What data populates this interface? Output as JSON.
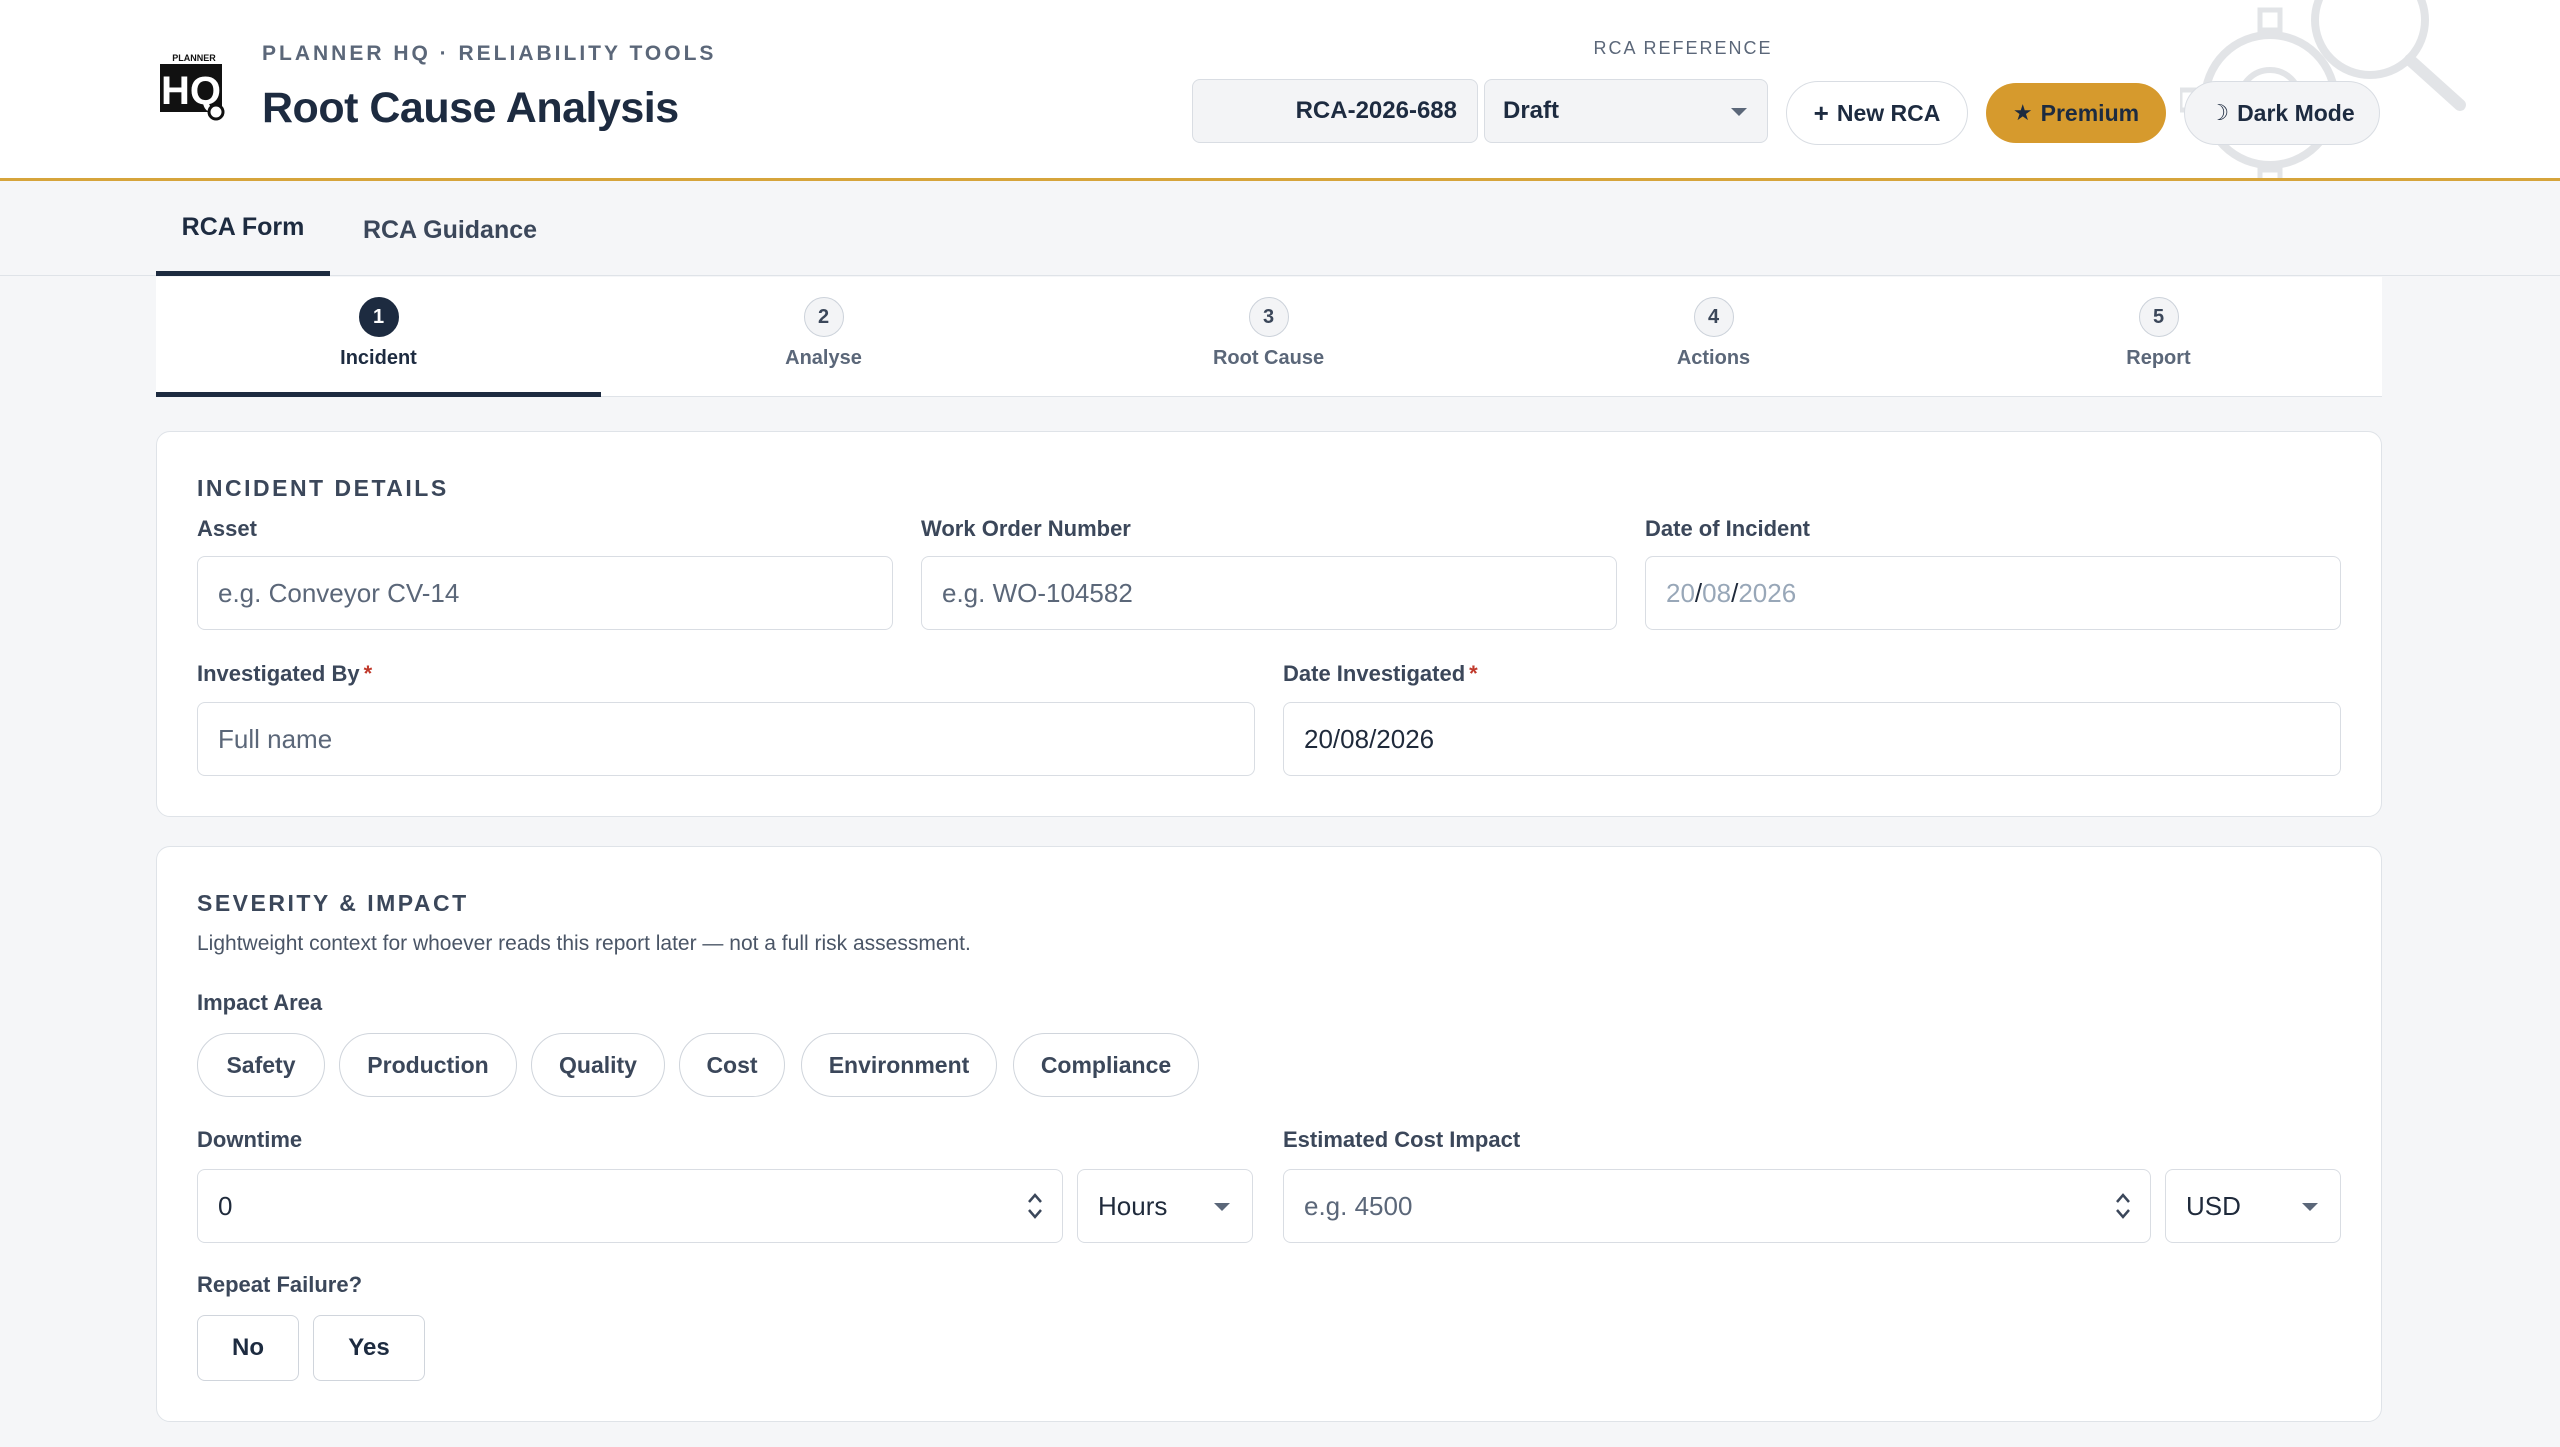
{
  "app": {
    "eyebrow": "PLANNER HQ · RELIABILITY TOOLS",
    "title": "Root Cause Analysis",
    "logo_text_top": "PLANNER",
    "logo_text_main": "HQ"
  },
  "header": {
    "rca_reference_label": "RCA REFERENCE",
    "rca_reference_value": "RCA-2026-688",
    "status_value": "Draft",
    "new_rca_label": "New RCA",
    "premium_label": "Premium",
    "dark_mode_label": "Dark Mode",
    "colors": {
      "accent": "#d6a43b",
      "premium_bg": "#d69a2d",
      "navy": "#1d2b40"
    }
  },
  "tabs": [
    {
      "label": "RCA Form",
      "active": true
    },
    {
      "label": "RCA Guidance",
      "active": false
    }
  ],
  "steps": [
    {
      "num": "1",
      "label": "Incident",
      "active": true
    },
    {
      "num": "2",
      "label": "Analyse",
      "active": false
    },
    {
      "num": "3",
      "label": "Root Cause",
      "active": false
    },
    {
      "num": "4",
      "label": "Actions",
      "active": false
    },
    {
      "num": "5",
      "label": "Report",
      "active": false
    }
  ],
  "incident": {
    "title": "INCIDENT DETAILS",
    "asset_label": "Asset",
    "asset_placeholder": "e.g. Conveyor CV-14",
    "work_order_label": "Work Order Number",
    "work_order_placeholder": "e.g. WO-104582",
    "date_incident_label": "Date of Incident",
    "date_incident_day": "20",
    "date_incident_month": "08",
    "date_incident_year": "2026",
    "date_sep": "/",
    "investigated_by_label": "Investigated By",
    "investigated_by_placeholder": "Full name",
    "required_mark": "*",
    "date_investigated_label": "Date Investigated",
    "date_investigated_value": "20/08/2026"
  },
  "severity": {
    "title": "SEVERITY & IMPACT",
    "helper": "Lightweight context for whoever reads this report later — not a full risk assessment.",
    "impact_area_label": "Impact Area",
    "impact_areas": [
      "Safety",
      "Production",
      "Quality",
      "Cost",
      "Environment",
      "Compliance"
    ],
    "downtime_label": "Downtime",
    "downtime_value": "0",
    "downtime_unit": "Hours",
    "cost_label": "Estimated Cost Impact",
    "cost_placeholder": "e.g. 4500",
    "currency": "USD",
    "repeat_failure_label": "Repeat Failure?",
    "repeat_no": "No",
    "repeat_yes": "Yes"
  }
}
